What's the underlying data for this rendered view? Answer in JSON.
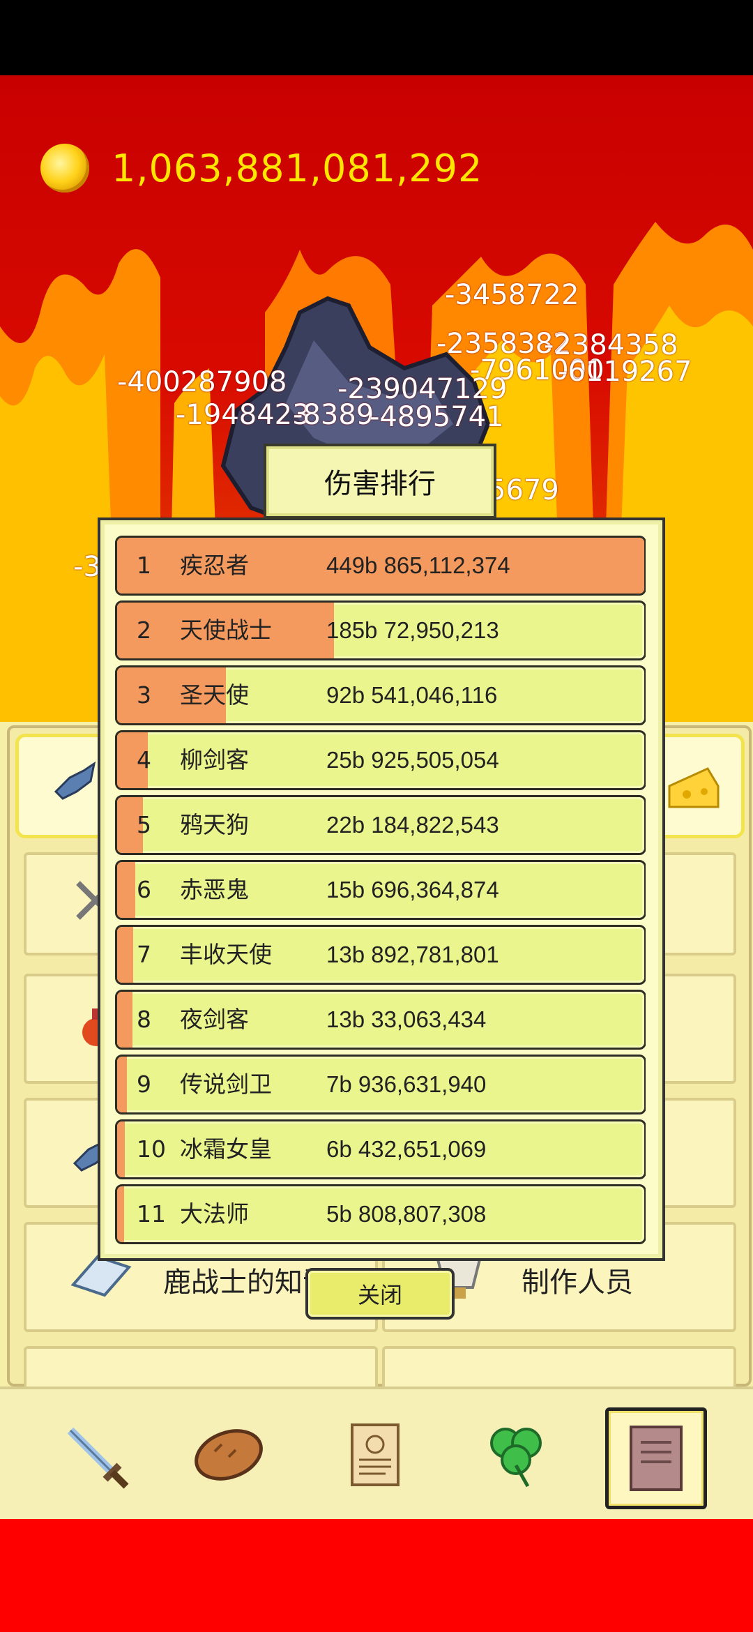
{
  "currency": {
    "icon": "gold-coin-icon",
    "value": "1,063,881,081,292"
  },
  "damage_popups": [
    "-3458722",
    "-2358382",
    "-2384358",
    "-7961000",
    "-6119267",
    "-400287908",
    "-239047129",
    "-1948423",
    "-8389",
    "-4895741",
    "5679",
    "-3"
  ],
  "dialog": {
    "title": "伤害排行",
    "close_label": "关闭",
    "rows": [
      {
        "rank": "1",
        "name": "疾忍者",
        "damage": "449b 865,112,374",
        "share": 1.0
      },
      {
        "rank": "2",
        "name": "天使战士",
        "damage": "185b 72,950,213",
        "share": 0.412
      },
      {
        "rank": "3",
        "name": "圣天使",
        "damage": "92b 541,046,116",
        "share": 0.206
      },
      {
        "rank": "4",
        "name": "柳剑客",
        "damage": "25b 925,505,054",
        "share": 0.058
      },
      {
        "rank": "5",
        "name": "鸦天狗",
        "damage": "22b 184,822,543",
        "share": 0.049
      },
      {
        "rank": "6",
        "name": "赤恶鬼",
        "damage": "15b 696,364,874",
        "share": 0.035
      },
      {
        "rank": "7",
        "name": "丰收天使",
        "damage": "13b 892,781,801",
        "share": 0.031
      },
      {
        "rank": "8",
        "name": "夜剑客",
        "damage": "13b 33,063,434",
        "share": 0.029
      },
      {
        "rank": "9",
        "name": "传说剑卫",
        "damage": "7b 936,631,940",
        "share": 0.018
      },
      {
        "rank": "10",
        "name": "冰霜女皇",
        "damage": "6b 432,651,069",
        "share": 0.014
      },
      {
        "rank": "11",
        "name": "大法师",
        "damage": "5b 808,807,308",
        "share": 0.013
      }
    ]
  },
  "panel": {
    "knowledge_label": "鹿战士的知识",
    "credits_label": "制作人员"
  },
  "nav": [
    {
      "icon": "sword-icon",
      "active": false
    },
    {
      "icon": "bread-icon",
      "active": false
    },
    {
      "icon": "scroll-icon",
      "active": false
    },
    {
      "icon": "clover-icon",
      "active": false
    },
    {
      "icon": "book-icon",
      "active": true
    }
  ],
  "colors": {
    "bar": "#f59a5e",
    "row": "#eaf58e",
    "gold": "#ffe600",
    "sky": "#d80a00"
  }
}
